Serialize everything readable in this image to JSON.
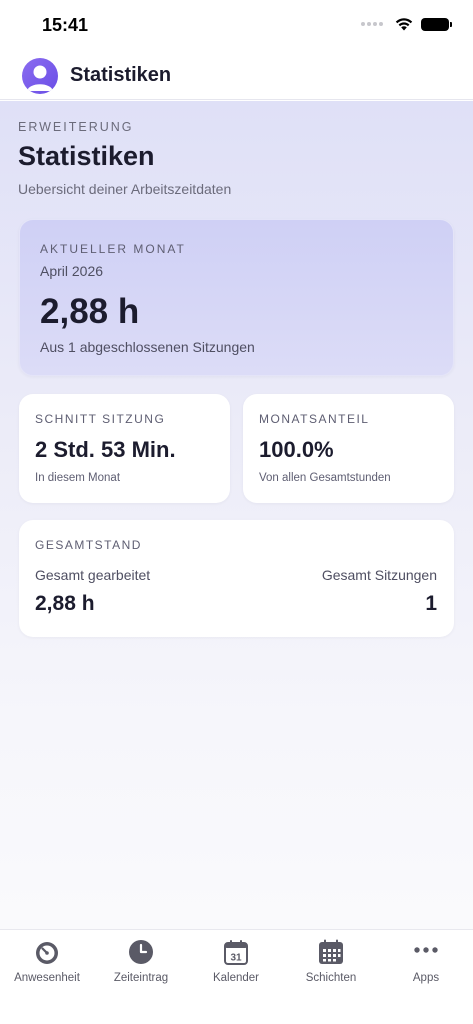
{
  "status_bar": {
    "time": "15:41"
  },
  "header": {
    "title": "Statistiken",
    "avatar_icon": "user-avatar-icon"
  },
  "page": {
    "eyebrow": "ERWEITERUNG",
    "title": "Statistiken",
    "subtitle": "Uebersicht deiner Arbeitszeitdaten"
  },
  "current_month": {
    "eyebrow": "AKTUELLER MONAT",
    "month": "April 2026",
    "value": "2,88 h",
    "caption": "Aus 1 abgeschlossenen Sitzungen"
  },
  "session_average": {
    "eyebrow": "SCHNITT SITZUNG",
    "value": "2 Std. 53 Min.",
    "caption": "In diesem Monat"
  },
  "month_share": {
    "eyebrow": "MONATSANTEIL",
    "value": "100.0%",
    "caption": "Von allen Gesamtstunden"
  },
  "totals": {
    "eyebrow": "GESAMTSTAND",
    "worked_label": "Gesamt gearbeitet",
    "worked_value": "2,88 h",
    "sessions_label": "Gesamt Sitzungen",
    "sessions_value": "1"
  },
  "tab_bar": {
    "items": [
      {
        "label": "Anwesenheit",
        "icon": "stopwatch-icon"
      },
      {
        "label": "Zeiteintrag",
        "icon": "clock-icon"
      },
      {
        "label": "Kalender",
        "icon": "calendar-icon"
      },
      {
        "label": "Schichten",
        "icon": "calendar-grid-icon"
      },
      {
        "label": "Apps",
        "icon": "more-dots-icon"
      }
    ],
    "calendar_day": "31"
  },
  "colors": {
    "accent": "#7357e8",
    "icon_gray": "#5a5a66",
    "hero_card": "#d4d5f6",
    "background_top": "#dfe0f7"
  }
}
